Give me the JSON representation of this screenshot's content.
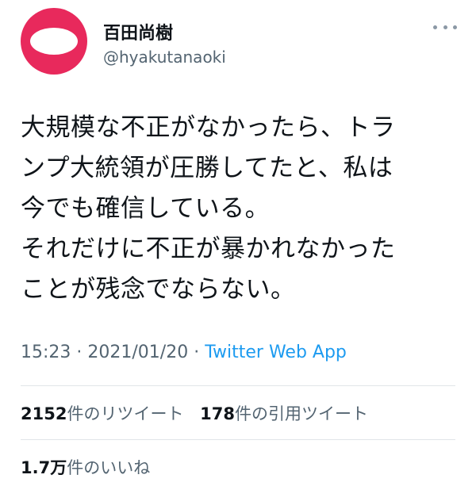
{
  "user": {
    "display_name": "百田尚樹",
    "username": "@hyakutanaoki",
    "avatar_color": "#e8295c"
  },
  "tweet": {
    "lines": [
      "大規模な不正がなかったら、トラ",
      "ンプ大統領が圧勝してたと、私は",
      "今でも確信している。",
      "それだけに不正が暴かれなかった",
      "ことが残念でならない。"
    ],
    "time": "15:23",
    "date": "2021/01/20",
    "separator": "·",
    "source": "Twitter Web App"
  },
  "stats": {
    "retweets_count": "2152",
    "retweets_label": "件のリツイート",
    "quotes_count": "178",
    "quotes_label": "件の引用ツイート",
    "likes_count": "1.7万",
    "likes_label": "件のいいね"
  },
  "icons": {
    "more": "more-horizontal-icon"
  },
  "colors": {
    "link": "#1d9bf0",
    "secondary_text": "#536471"
  }
}
